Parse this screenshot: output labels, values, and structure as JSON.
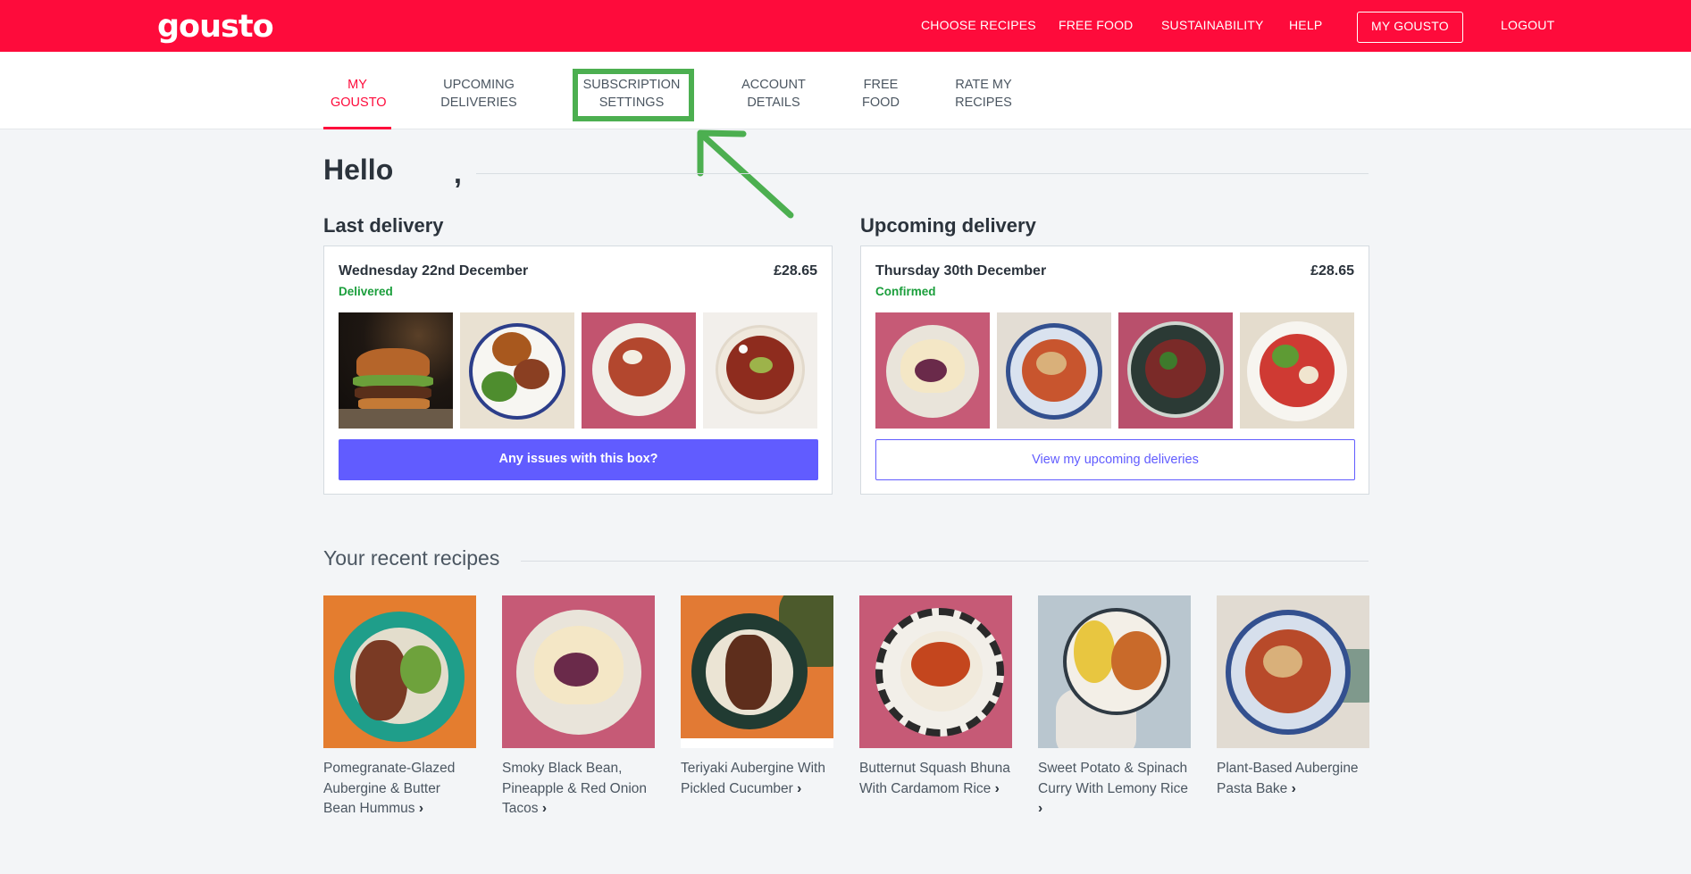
{
  "brand": {
    "logo_text": "gousto",
    "primary_color": "#fe0b3b",
    "accent_color": "#615cff",
    "success_color": "#1a9e3b"
  },
  "top_nav": {
    "items": [
      "CHOOSE RECIPES",
      "FREE FOOD",
      "SUSTAINABILITY",
      "HELP"
    ],
    "my_gousto": "MY GOUSTO",
    "logout": "LOGOUT"
  },
  "sub_nav": {
    "tabs": [
      {
        "line1": "MY",
        "line2": "GOUSTO",
        "active": true
      },
      {
        "line1": "UPCOMING",
        "line2": "DELIVERIES",
        "active": false
      },
      {
        "line1": "SUBSCRIPTION",
        "line2": "SETTINGS",
        "active": false,
        "highlighted": true
      },
      {
        "line1": "ACCOUNT",
        "line2": "DETAILS",
        "active": false
      },
      {
        "line1": "FREE",
        "line2": "FOOD",
        "active": false
      },
      {
        "line1": "RATE MY",
        "line2": "RECIPES",
        "active": false
      }
    ]
  },
  "greeting": {
    "hello": "Hello",
    "comma": ","
  },
  "last_delivery": {
    "heading": "Last delivery",
    "date": "Wednesday 22nd December",
    "price": "£28.65",
    "status": "Delivered",
    "button": "Any issues with this box?"
  },
  "upcoming_delivery": {
    "heading": "Upcoming delivery",
    "date": "Thursday 30th December",
    "price": "£28.65",
    "status": "Confirmed",
    "button": "View my upcoming deliveries"
  },
  "recent_recipes": {
    "heading": "Your recent recipes",
    "items": [
      {
        "name": "Pomegranate-Glazed Aubergine & Butter Bean Hummus"
      },
      {
        "name": "Smoky Black Bean, Pineapple & Red Onion Tacos"
      },
      {
        "name": "Teriyaki Aubergine With Pickled Cucumber"
      },
      {
        "name": "Butternut Squash Bhuna With Cardamom Rice"
      },
      {
        "name": "Sweet Potato & Spinach Curry With Lemony Rice"
      },
      {
        "name": "Plant-Based Aubergine Pasta Bake"
      }
    ]
  },
  "icons": {
    "chevron": "chevron-right-icon",
    "annotation": "green-arrow-icon"
  }
}
